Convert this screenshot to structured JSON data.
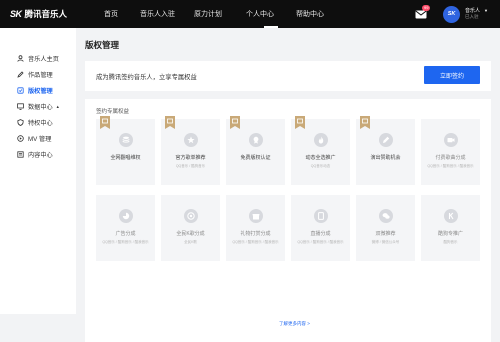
{
  "header": {
    "logo_mark": "SK",
    "logo_text": "腾讯音乐人",
    "nav": [
      "首页",
      "音乐人入驻",
      "原力计划",
      "个人中心",
      "帮助中心"
    ],
    "active_nav": "个人中心",
    "mail_badge": "99",
    "avatar_text": "SK",
    "user_name": "音乐人",
    "user_role": "已入驻"
  },
  "sidebar": {
    "items": [
      {
        "label": "音乐人主页",
        "icon": "user-icon"
      },
      {
        "label": "作品管理",
        "icon": "edit-icon"
      },
      {
        "label": "版权管理",
        "icon": "copyright-icon"
      },
      {
        "label": "数据中心",
        "icon": "chart-icon",
        "expand": "▲"
      },
      {
        "label": "特权中心",
        "icon": "privilege-icon"
      },
      {
        "label": "MV 管理",
        "icon": "mv-icon"
      },
      {
        "label": "内容中心",
        "icon": "content-icon"
      }
    ],
    "active_label": "版权管理"
  },
  "main": {
    "title": "版权管理",
    "banner_text": "成为腾讯签约音乐人，立享专属权益",
    "banner_button": "立即签约",
    "benefits_title": "签约专属权益",
    "benefits": [
      {
        "name": "全网翻唱维权",
        "sub": "",
        "ribbon": true,
        "icon": "database-icon"
      },
      {
        "name": "官方歌单推荐",
        "sub": "QQ音乐 / 酷狗音乐",
        "ribbon": true,
        "icon": "star-icon"
      },
      {
        "name": "免费版权认证",
        "sub": "",
        "ribbon": true,
        "icon": "badge-icon"
      },
      {
        "name": "动态全选推广",
        "sub": "QQ音乐动态",
        "ribbon": true,
        "icon": "flame-icon"
      },
      {
        "name": "演出赞助机会",
        "sub": "",
        "ribbon": true,
        "icon": "mic-icon"
      },
      {
        "name": "付费歌曲分成",
        "sub": "QQ音乐 / 酷狗音乐 / 酷我音乐",
        "ribbon": false,
        "icon": "video-icon"
      },
      {
        "name": "广告分成",
        "sub": "QQ音乐 / 酷狗音乐 / 酷我音乐",
        "ribbon": false,
        "icon": "pie-icon"
      },
      {
        "name": "全民K歌分成",
        "sub": "全民K歌",
        "ribbon": false,
        "icon": "globe-icon"
      },
      {
        "name": "礼物打赏分成",
        "sub": "QQ音乐 / 酷狗音乐 / 酷我音乐",
        "ribbon": false,
        "icon": "gift-icon"
      },
      {
        "name": "直播分成",
        "sub": "QQ音乐 / 酷狗音乐 / 酷我音乐",
        "ribbon": false,
        "icon": "tablet-icon"
      },
      {
        "name": "双微推荐",
        "sub": "微博 / 微信公众号",
        "ribbon": false,
        "icon": "wechat-icon"
      },
      {
        "name": "酷狗专推广",
        "sub": "酷狗音乐",
        "ribbon": false,
        "icon": "k-icon"
      }
    ],
    "more_link": "了解更多内容 >"
  },
  "colors": {
    "accent": "#1e66f0",
    "topbar": "#0e0e0e",
    "ribbon": "#c9a978",
    "badge": "#ff4d6a"
  }
}
